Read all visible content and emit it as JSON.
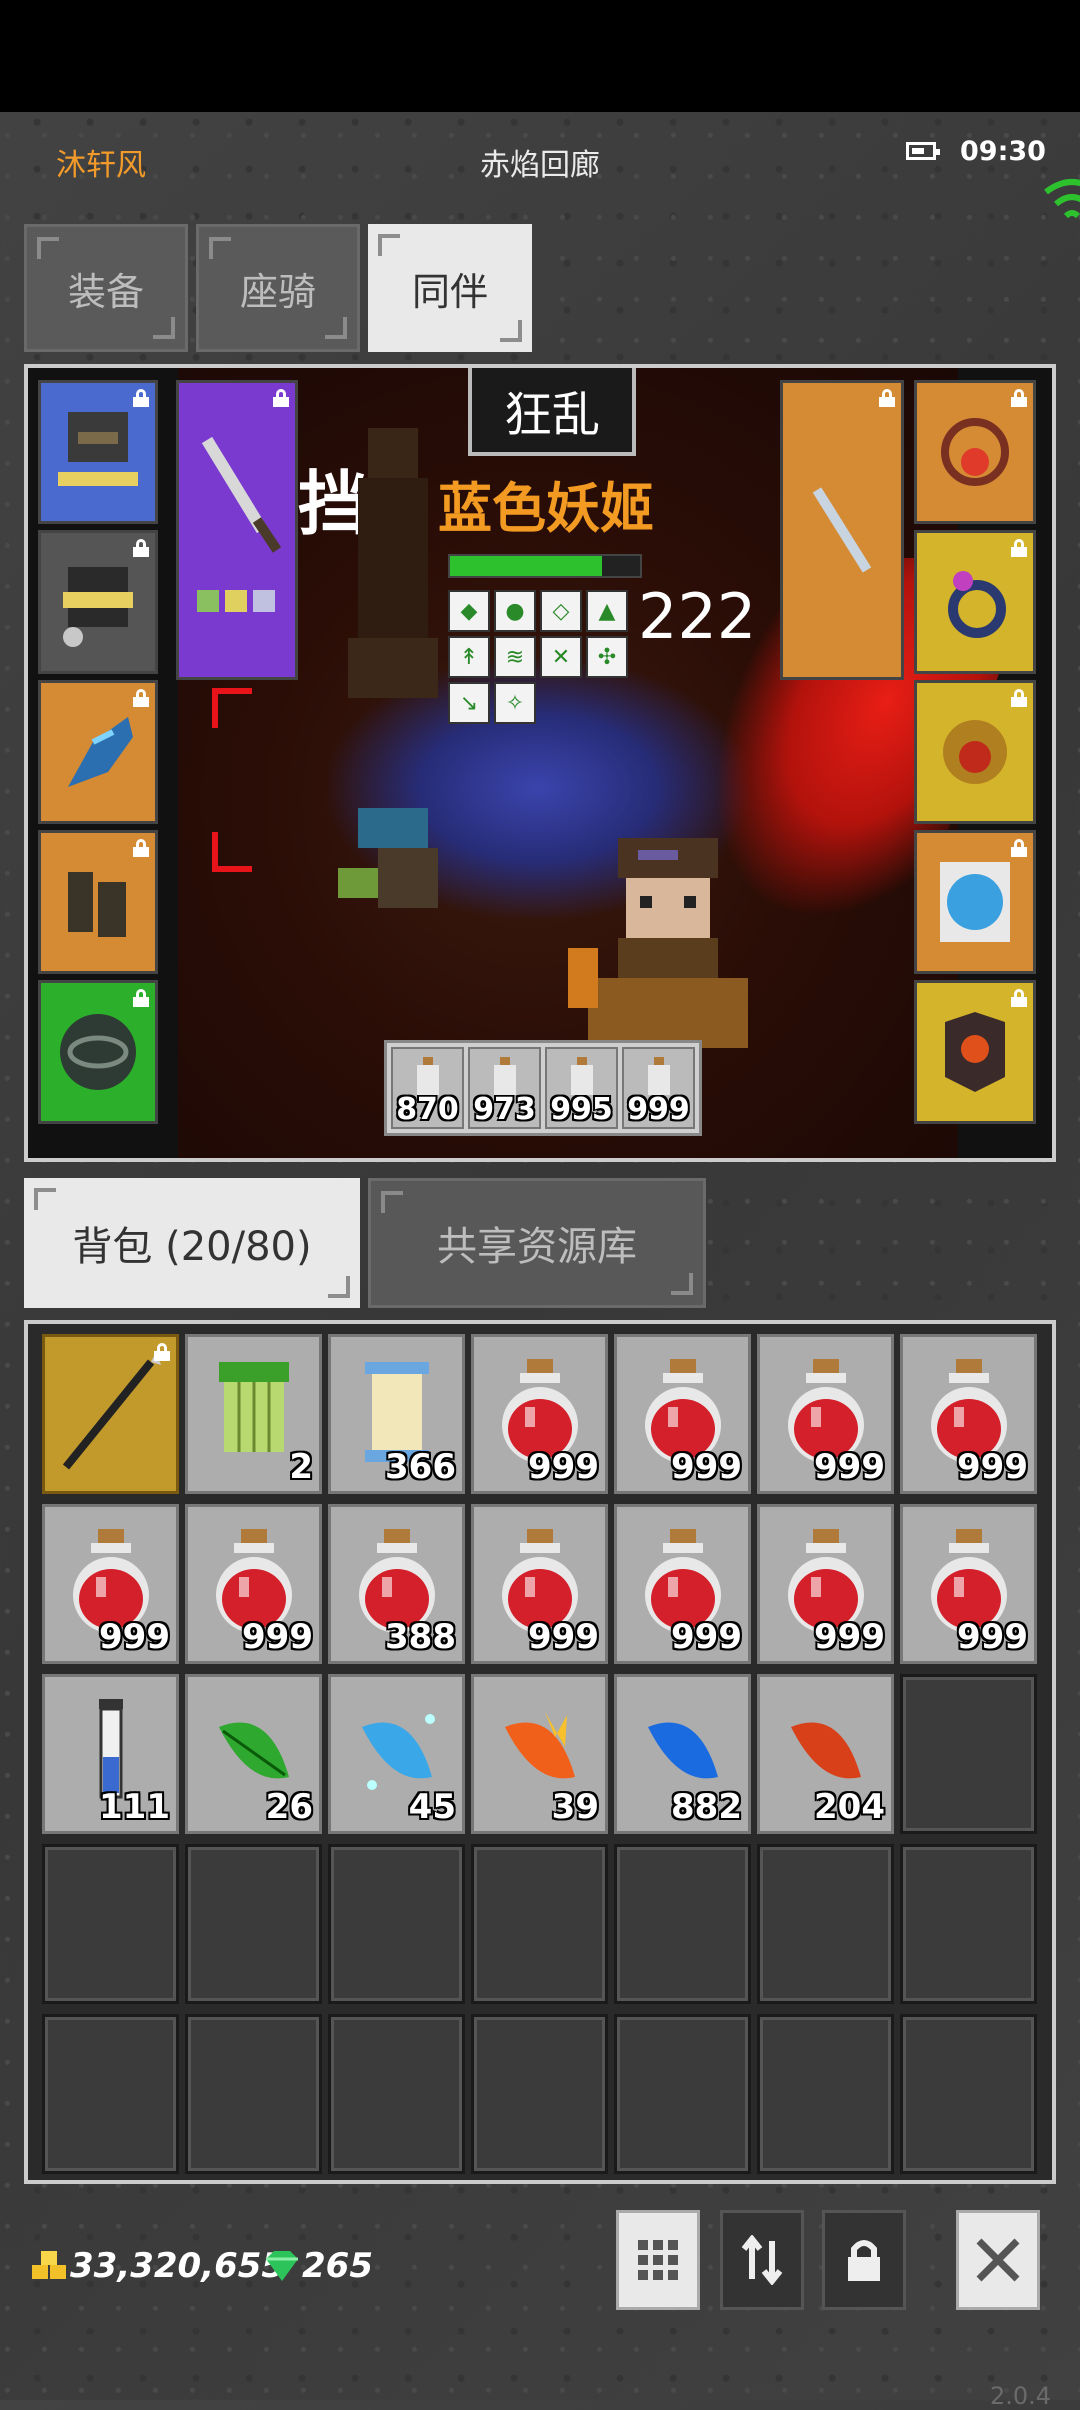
{
  "header": {
    "player_name": "沐轩风",
    "map_name": "赤焰回廊",
    "time": "09:30"
  },
  "tabs": {
    "equip": "装备",
    "mount": "座骑",
    "companion": "同伴",
    "active": "companion"
  },
  "scene": {
    "title": "狂乱",
    "boss_name": "蓝色妖姬",
    "overlay_text": "挡",
    "damage_text": "222",
    "hp_fraction": 0.8
  },
  "quick_potions": [
    {
      "count": "870"
    },
    {
      "count": "973"
    },
    {
      "count": "995"
    },
    {
      "count": "999"
    }
  ],
  "bag_tabs": {
    "backpack": "背包 (20/80)",
    "shared": "共享资源库"
  },
  "bag_items": [
    {
      "icon": "spear-icon",
      "count": "",
      "selected": true
    },
    {
      "icon": "bamboo-armor-icon",
      "count": "2"
    },
    {
      "icon": "scroll-icon",
      "count": "366"
    },
    {
      "icon": "red-potion-icon",
      "count": "999"
    },
    {
      "icon": "red-potion-icon",
      "count": "999"
    },
    {
      "icon": "red-potion-icon",
      "count": "999"
    },
    {
      "icon": "red-potion-icon",
      "count": "999"
    },
    {
      "icon": "red-potion-icon",
      "count": "999"
    },
    {
      "icon": "red-potion-icon",
      "count": "999"
    },
    {
      "icon": "red-potion-icon",
      "count": "388"
    },
    {
      "icon": "red-potion-icon",
      "count": "999"
    },
    {
      "icon": "red-potion-icon",
      "count": "999"
    },
    {
      "icon": "red-potion-icon",
      "count": "999"
    },
    {
      "icon": "red-potion-icon",
      "count": "999"
    },
    {
      "icon": "test-tube-icon",
      "count": "111"
    },
    {
      "icon": "green-leaf-icon",
      "count": "26"
    },
    {
      "icon": "ice-leaf-icon",
      "count": "45"
    },
    {
      "icon": "fire-feather-icon",
      "count": "39"
    },
    {
      "icon": "blue-leaf-icon",
      "count": "882"
    },
    {
      "icon": "red-leaf-icon",
      "count": "204"
    }
  ],
  "currency": {
    "gold": "33,320,655",
    "gems": "265"
  },
  "version": "2.0.4",
  "colors": {
    "accent_orange": "#f29a2a",
    "gold_slot": "#c29a2c"
  }
}
